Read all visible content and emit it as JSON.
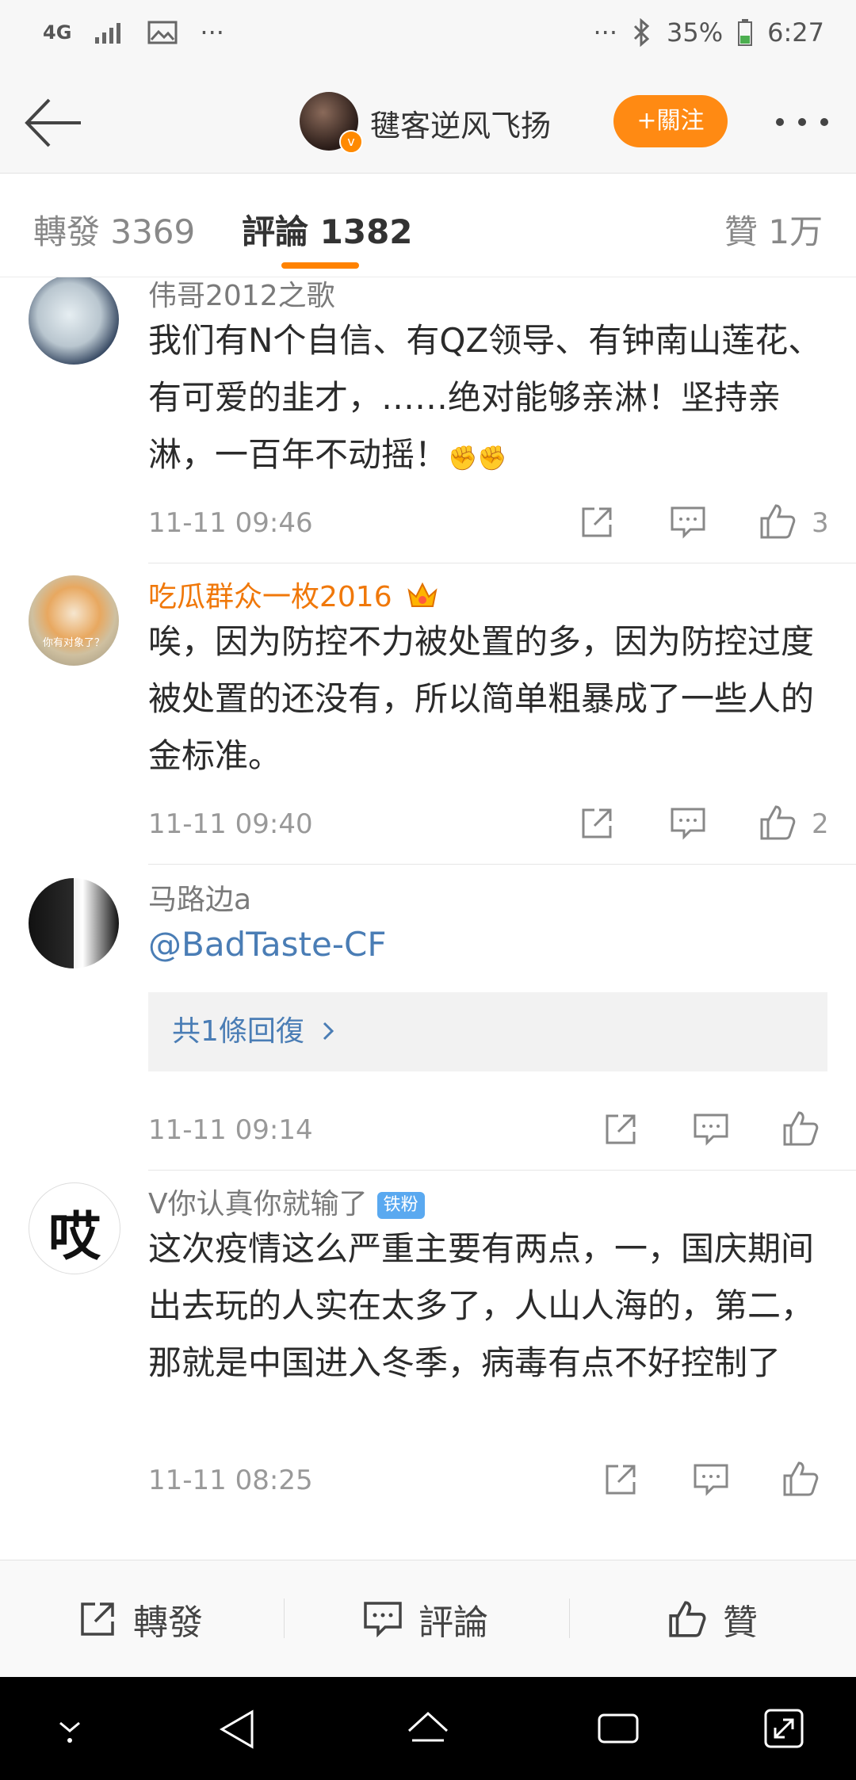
{
  "status_bar": {
    "network": "4G",
    "battery": "35%",
    "time": "6:27",
    "overflow_left": "···",
    "overflow_right": "···"
  },
  "header": {
    "username": "毽客逆风飞扬",
    "follow_label": "+關注",
    "accent": "#ff8a13"
  },
  "tabs": [
    {
      "label": "轉發 3369",
      "active": false
    },
    {
      "label": "評論 1382",
      "active": true
    },
    {
      "label": "贊 1万",
      "active": false
    }
  ],
  "comments": [
    {
      "name": "伟哥2012之歌",
      "text": "我们有N个自信、有QZ领导、有钟南山莲花、有可爱的韭才，……绝对能够亲淋！坚持亲淋，一百年不动摇！",
      "emoji": "✊✊",
      "time": "11-11 09:46",
      "likes": "3"
    },
    {
      "name": "吃瓜群众一枚2016",
      "vip_icon": "crown-icon",
      "avatar_caption": "你有对象了？",
      "text": "唉，因为防控不力被处置的多，因为防控过度被处置的还没有，所以简单粗暴成了一些人的金标准。",
      "time": "11-11 09:40",
      "likes": "2"
    },
    {
      "name": "马路边a",
      "text": "@BadTaste-CF",
      "reply_summary": "共1條回復",
      "time": "11-11 09:14",
      "likes": ""
    },
    {
      "name": "V你认真你就输了",
      "badge": "铁粉",
      "avatar_glyph": "哎",
      "text": "这次疫情这么严重主要有两点，一，国庆期间出去玩的人实在太多了，人山人海的，第二，那就是中国进入冬季，病毒有点不好控制了",
      "time": "11-11 08:25",
      "likes": ""
    }
  ],
  "bottom_bar": {
    "repost": "轉發",
    "comment": "評論",
    "like": "贊"
  }
}
